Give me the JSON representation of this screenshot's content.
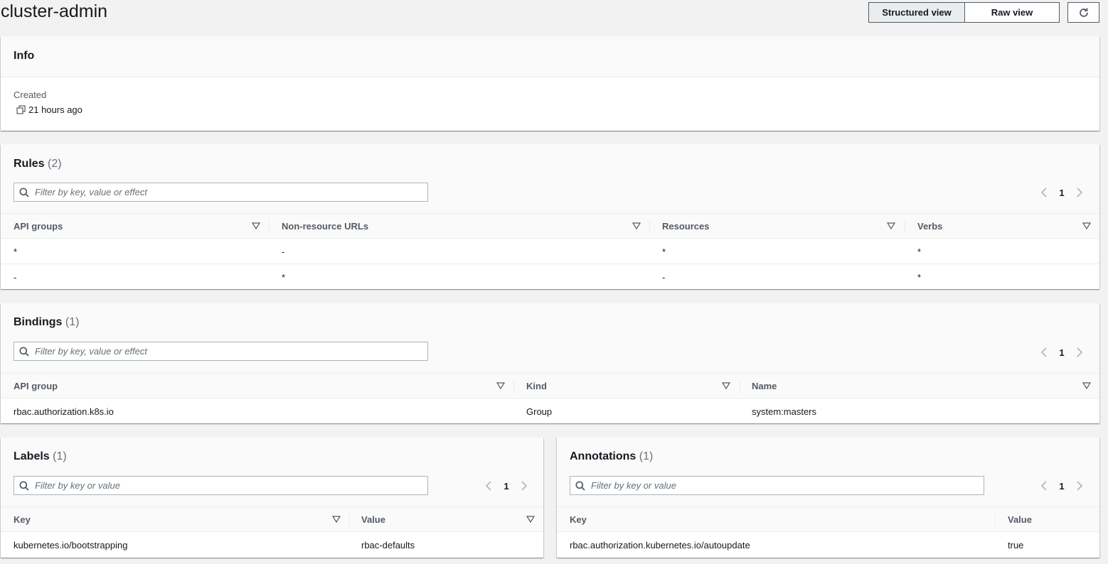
{
  "header": {
    "title": "cluster-admin",
    "structured_view": "Structured view",
    "raw_view": "Raw view"
  },
  "info": {
    "title": "Info",
    "created_label": "Created",
    "created_value": "21 hours ago"
  },
  "rules": {
    "title": "Rules",
    "count": "(2)",
    "search_placeholder": "Filter by key, value or effect",
    "page": "1",
    "columns": [
      "API groups",
      "Non-resource URLs",
      "Resources",
      "Verbs"
    ],
    "rows": [
      [
        "*",
        "-",
        "*",
        "*"
      ],
      [
        "-",
        "*",
        "-",
        "*"
      ]
    ]
  },
  "bindings": {
    "title": "Bindings",
    "count": "(1)",
    "search_placeholder": "Filter by key, value or effect",
    "page": "1",
    "columns": [
      "API group",
      "Kind",
      "Name"
    ],
    "rows": [
      [
        "rbac.authorization.k8s.io",
        "Group",
        "system:masters"
      ]
    ]
  },
  "labels": {
    "title": "Labels",
    "count": "(1)",
    "search_placeholder": "Filter by key or value",
    "page": "1",
    "columns": [
      "Key",
      "Value"
    ],
    "rows": [
      [
        "kubernetes.io/bootstrapping",
        "rbac-defaults"
      ]
    ]
  },
  "annotations": {
    "title": "Annotations",
    "count": "(1)",
    "search_placeholder": "Filter by key or value",
    "page": "1",
    "columns": [
      "Key",
      "Value"
    ],
    "rows": [
      [
        "rbac.authorization.kubernetes.io/autoupdate",
        "true"
      ]
    ]
  }
}
